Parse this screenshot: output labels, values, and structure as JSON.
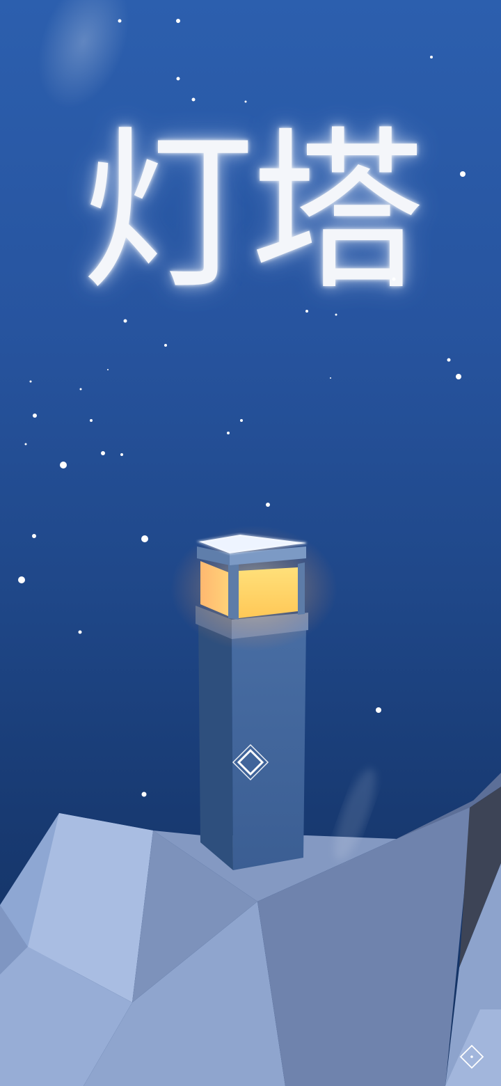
{
  "game": {
    "title": "灯塔"
  },
  "controls": {
    "start_icon": "diamond-icon",
    "menu_icon": "small-diamond-icon"
  },
  "colors": {
    "sky_top": "#2c5fae",
    "sky_bottom": "#12305f",
    "lamp_glow": "#ffd070",
    "rock_light": "#a3b8dd",
    "tower": "#3f6294"
  }
}
